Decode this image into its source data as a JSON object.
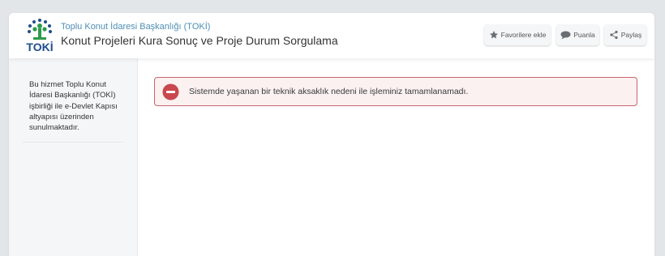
{
  "header": {
    "subtitle": "Toplu Konut İdaresi Başkanlığı (TOKİ)",
    "title": "Konut Projeleri Kura Sonuç ve Proje Durum Sorgulama",
    "logo_text": "TOKİ",
    "buttons": {
      "favorites": {
        "label": "Favorilere ekle",
        "icon": "star-icon"
      },
      "rate": {
        "label": "Puanla",
        "icon": "speech-bubble-icon"
      },
      "share": {
        "label": "Paylaş",
        "icon": "share-icon"
      }
    }
  },
  "sidebar": {
    "info": "Bu hizmet Toplu Konut İdaresi Başkanlığı (TOKİ) işbirliği ile e-Devlet Kapısı altyapısı üzerinden sunulmaktadır."
  },
  "alert": {
    "icon": "error-circle-icon",
    "message": "Sistemde yaşanan bir teknik aksaklık nedeni ile işleminiz tamamlanamadı."
  },
  "colors": {
    "page_bg": "#e3e6e9",
    "link_blue": "#4e8fb5",
    "toki_green": "#2d9a4c",
    "toki_blue": "#1f4d8c",
    "alert_red": "#c9474e",
    "alert_bg": "#fbf1f1"
  }
}
